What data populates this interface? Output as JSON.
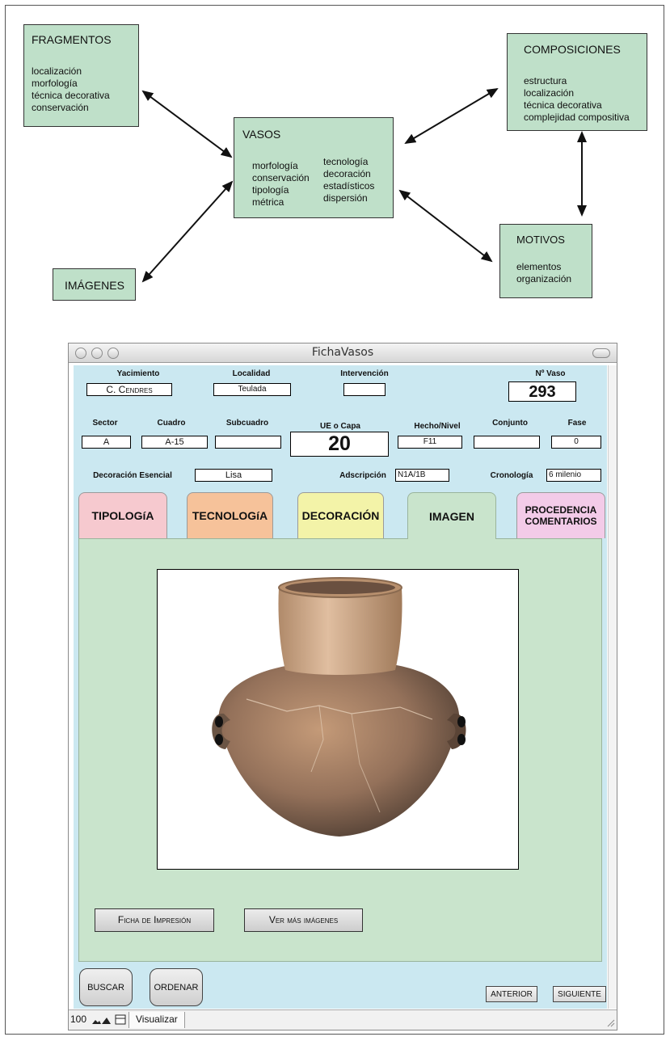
{
  "diagram": {
    "fragmentos": {
      "title": "FRAGMENTOS",
      "items": [
        "localización",
        "morfología",
        "técnica decorativa",
        "conservación"
      ]
    },
    "vasos": {
      "title": "VASOS",
      "left_items": [
        "morfología",
        "conservación",
        "tipología",
        "métrica"
      ],
      "right_items": [
        "tecnología",
        "decoración",
        "estadísticos",
        "dispersión"
      ]
    },
    "composiciones": {
      "title": "COMPOSICIONES",
      "items": [
        "estructura",
        "localización",
        "técnica decorativa",
        "complejidad compositiva"
      ]
    },
    "motivos": {
      "title": "MOTIVOS",
      "items": [
        "elementos",
        "organización"
      ]
    },
    "imagenes": {
      "title": "IMÁGENES"
    }
  },
  "window": {
    "title": "FichaVasos",
    "fields": {
      "yacimiento": {
        "label": "Yacimiento",
        "value": "C. Cendres"
      },
      "localidad": {
        "label": "Localidad",
        "value": "Teulada"
      },
      "intervencion": {
        "label": "Intervención",
        "value": ""
      },
      "n_vaso": {
        "label": "Nº Vaso",
        "value": "293"
      },
      "sector": {
        "label": "Sector",
        "value": "A"
      },
      "cuadro": {
        "label": "Cuadro",
        "value": "A-15"
      },
      "subcuadro": {
        "label": "Subcuadro",
        "value": ""
      },
      "ue_capa": {
        "label": "UE o Capa",
        "value": "20"
      },
      "hecho_nivel": {
        "label": "Hecho/Nivel",
        "value": "F11"
      },
      "conjunto": {
        "label": "Conjunto",
        "value": ""
      },
      "fase": {
        "label": "Fase",
        "value": "0"
      },
      "decoracion_esencial": {
        "label": "Decoración Esencial",
        "value": "Lisa"
      },
      "adscripcion": {
        "label": "Adscripción",
        "value": "N1A/1B"
      },
      "cronologia": {
        "label": "Cronología",
        "value": "6 milenio"
      }
    },
    "tabs": [
      {
        "label": "TIPOLOGíA",
        "color": "#f6c9cf"
      },
      {
        "label": "TECNOLOGíA",
        "color": "#f6c29a"
      },
      {
        "label": "DECORACIÓN",
        "color": "#f3f3a8"
      },
      {
        "label": "IMAGEN",
        "color": "#c9e4cc",
        "active": true
      },
      {
        "label": "PROCEDENCIA COMENTARIOS",
        "color": "#f3cbe8"
      }
    ],
    "buttons": {
      "ficha_impresion": "Ficha de Impresión",
      "ver_mas": "Ver más imágenes",
      "buscar": "BUSCAR",
      "ordenar": "ORDENAR",
      "anterior": "ANTERIOR",
      "siguiente": "SIGUIENTE"
    },
    "status": {
      "zoom": "100",
      "mode": "Visualizar"
    }
  }
}
